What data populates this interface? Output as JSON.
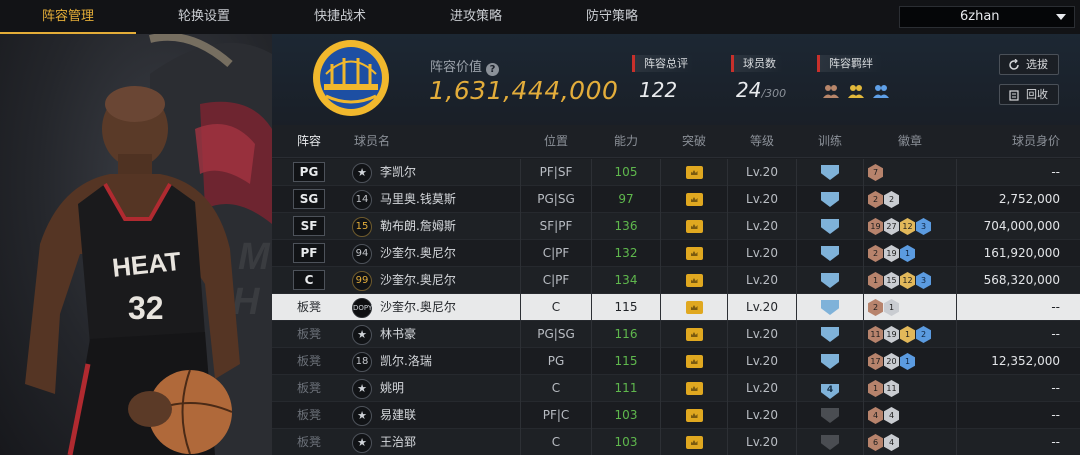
{
  "nav": {
    "tabs": [
      "阵容管理",
      "轮换设置",
      "快捷战术",
      "进攻策略",
      "防守策略"
    ],
    "active_tab": "阵容管理",
    "team_select": "6zhan"
  },
  "hero": {
    "jersey_text": "HEAT",
    "jersey_number": "32"
  },
  "header": {
    "value_label": "阵容价值",
    "value": "1,631,444,000",
    "rating_label": "阵容总评",
    "rating": "122",
    "players_label": "球员数",
    "players_count": "24",
    "players_max": "/300",
    "bond_label": "阵容羁绊",
    "buttons": {
      "pick": "选拔",
      "recycle": "回收"
    }
  },
  "table": {
    "headers": {
      "slot": "阵容",
      "name": "球员名",
      "pos": "位置",
      "ovr": "能力",
      "breakthrough": "突破",
      "level": "等级",
      "training": "训练",
      "badges": "徽章",
      "salary": "球员身价"
    },
    "rows": [
      {
        "slot": "PG",
        "starter": true,
        "num": "★",
        "num_style": "star",
        "name": "李凯尔",
        "pos": "PF|SF",
        "ovr": "105",
        "level": "Lv.20",
        "training": "",
        "badges": [
          [
            "bronze",
            "7"
          ]
        ],
        "salary": "--"
      },
      {
        "slot": "SG",
        "starter": true,
        "num": "14",
        "num_style": "",
        "name": "马里奥.钱莫斯",
        "pos": "PG|SG",
        "ovr": "97",
        "level": "Lv.20",
        "training": "",
        "badges": [
          [
            "bronze",
            "2"
          ],
          [
            "silver",
            "2"
          ]
        ],
        "salary": "2,752,000"
      },
      {
        "slot": "SF",
        "starter": true,
        "num": "15",
        "num_style": "gold",
        "name": "勒布朗.詹姆斯",
        "pos": "SF|PF",
        "ovr": "136",
        "level": "Lv.20",
        "training": "",
        "badges": [
          [
            "bronze",
            "19"
          ],
          [
            "silver",
            "27"
          ],
          [
            "gold",
            "12"
          ],
          [
            "blue",
            "3"
          ]
        ],
        "salary": "704,000,000"
      },
      {
        "slot": "PF",
        "starter": true,
        "num": "94",
        "num_style": "",
        "name": "沙奎尔.奥尼尔",
        "pos": "C|PF",
        "ovr": "132",
        "level": "Lv.20",
        "training": "",
        "badges": [
          [
            "bronze",
            "2"
          ],
          [
            "silver",
            "19"
          ],
          [
            "blue",
            "1"
          ]
        ],
        "salary": "161,920,000"
      },
      {
        "slot": "C",
        "starter": true,
        "num": "99",
        "num_style": "gold",
        "name": "沙奎尔.奥尼尔",
        "pos": "C|PF",
        "ovr": "134",
        "level": "Lv.20",
        "training": "",
        "badges": [
          [
            "bronze",
            "1"
          ],
          [
            "silver",
            "15"
          ],
          [
            "gold",
            "12"
          ],
          [
            "blue",
            "3"
          ]
        ],
        "salary": "568,320,000"
      },
      {
        "slot": "板凳",
        "starter": false,
        "selected": true,
        "num": "DOPY",
        "num_style": "badge",
        "name": "沙奎尔.奥尼尔",
        "pos": "C",
        "ovr": "115",
        "level": "Lv.20",
        "training": "",
        "badges": [
          [
            "bronze",
            "2"
          ],
          [
            "silver",
            "1"
          ]
        ],
        "salary": "--"
      },
      {
        "slot": "板凳",
        "starter": false,
        "num": "★",
        "num_style": "star",
        "name": "林书豪",
        "pos": "PG|SG",
        "ovr": "116",
        "level": "Lv.20",
        "training": "",
        "badges": [
          [
            "bronze",
            "11"
          ],
          [
            "silver",
            "19"
          ],
          [
            "gold",
            "1"
          ],
          [
            "blue",
            "2"
          ]
        ],
        "salary": "--"
      },
      {
        "slot": "板凳",
        "starter": false,
        "num": "18",
        "num_style": "",
        "name": "凯尔.洛瑞",
        "pos": "PG",
        "ovr": "115",
        "level": "Lv.20",
        "training": "",
        "badges": [
          [
            "bronze",
            "17"
          ],
          [
            "silver",
            "20"
          ],
          [
            "blue",
            "1"
          ]
        ],
        "salary": "12,352,000"
      },
      {
        "slot": "板凳",
        "starter": false,
        "num": "★",
        "num_style": "star",
        "name": "姚明",
        "pos": "C",
        "ovr": "111",
        "level": "Lv.20",
        "training": "4",
        "badges": [
          [
            "bronze",
            "1"
          ],
          [
            "silver",
            "11"
          ]
        ],
        "salary": "--"
      },
      {
        "slot": "板凳",
        "starter": false,
        "num": "★",
        "num_style": "star",
        "name": "易建联",
        "pos": "PF|C",
        "ovr": "103",
        "level": "Lv.20",
        "training": "grey",
        "badges": [
          [
            "bronze",
            "4"
          ],
          [
            "silver",
            "4"
          ]
        ],
        "salary": "--"
      },
      {
        "slot": "板凳",
        "starter": false,
        "num": "★",
        "num_style": "star",
        "name": "王治郅",
        "pos": "C",
        "ovr": "103",
        "level": "Lv.20",
        "training": "grey",
        "badges": [
          [
            "bronze",
            "6"
          ],
          [
            "silver",
            "4"
          ]
        ],
        "salary": "--"
      }
    ]
  },
  "colors": {
    "accent_gold": "#e3ad3b",
    "ovr_green": "#5fb84d",
    "label_red": "#c8302b"
  },
  "icons": [
    "help-icon",
    "team-logo",
    "bond-icon",
    "refresh-icon",
    "recycle-icon",
    "crown-icon",
    "training-shield-icon",
    "badge-hex-icon",
    "dropdown-caret-icon"
  ]
}
